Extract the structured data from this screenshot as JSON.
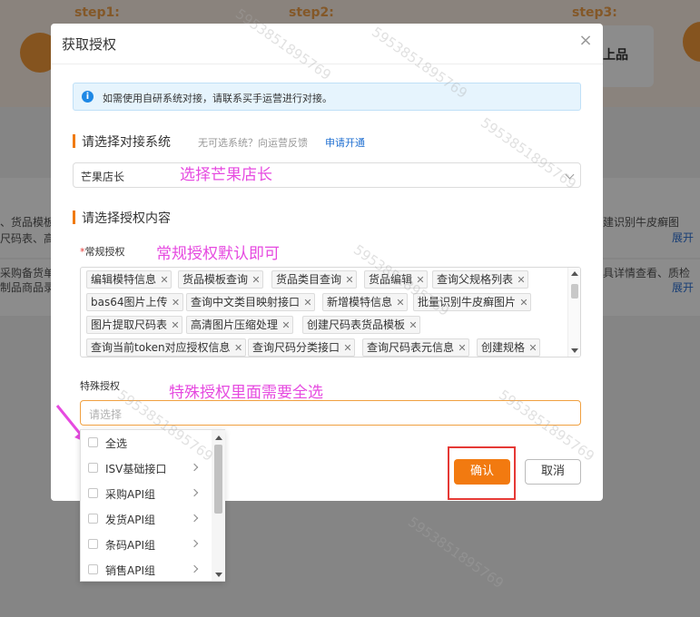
{
  "background": {
    "steps": [
      "step1:",
      "step2:",
      "step3:"
    ],
    "step3_text": "上品",
    "row1_left_lines": [
      "、货品模板",
      "尺码表、高"
    ],
    "row1_right_text": "建识别牛皮癣图",
    "row2_left_lines": [
      "采购备货单",
      "制品商品录"
    ],
    "row2_right_text": "具详情查看、质检",
    "expand_label": "展开"
  },
  "modal": {
    "title": "获取授权",
    "close_symbol": "×",
    "notice": "如需使用自研系统对接，请联系买手运营进行对接。",
    "section1": {
      "title": "请选择对接系统",
      "hint": "无可选系统？向运营反馈",
      "apply_link": "申请开通"
    },
    "system_select": {
      "value": "芒果店长"
    },
    "section2": {
      "title": "请选择授权内容"
    },
    "regular_auth": {
      "required_mark": "*",
      "label": "常规授权",
      "tags": [
        "编辑模特信息",
        "货品模板查询",
        "货品类目查询",
        "货品编辑",
        "查询父规格列表",
        "bas64图片上传",
        "查询中文类目映射接口",
        "新增模特信息",
        "批量识别牛皮癣图片",
        "图片提取尺码表",
        "高清图片压缩处理",
        "创建尺码表货品模板",
        "查询当前token对应授权信息",
        "查询尺码分类接口",
        "查询尺码表元信息",
        "创建规格"
      ]
    },
    "special_auth": {
      "label": "特殊授权",
      "placeholder": "请选择"
    },
    "confirm_label": "确认",
    "cancel_label": "取消"
  },
  "dropdown": {
    "items": [
      {
        "label": "全选",
        "has_children": false
      },
      {
        "label": "ISV基础接口",
        "has_children": true
      },
      {
        "label": "采购API组",
        "has_children": true
      },
      {
        "label": "发货API组",
        "has_children": true
      },
      {
        "label": "条码API组",
        "has_children": true
      },
      {
        "label": "销售API组",
        "has_children": true
      }
    ]
  },
  "annotations": {
    "system_note": "选择芒果店长",
    "regular_note": "常规授权默认即可",
    "special_note": "特殊授权里面需要全选"
  },
  "watermark_text": "5953851895769",
  "colors": {
    "accent": "#f27a10",
    "annotation": "#e64ae0",
    "highlight_frame": "#e53935",
    "link": "#1f6fd1"
  }
}
